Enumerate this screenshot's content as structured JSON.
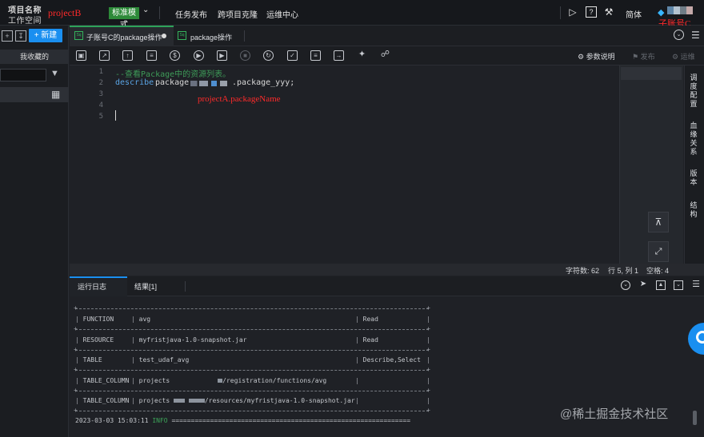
{
  "header": {
    "logo_line1": "项目名称",
    "logo_line2": "工作空间",
    "logo_annotation": "projectB",
    "mode": "标准模式",
    "nav": [
      "任务发布",
      "跨项目克隆",
      "运维中心"
    ],
    "lang": "简体",
    "account_annotation": "子账号C"
  },
  "sidebar": {
    "new_button": "+ 新建",
    "favorites_tab": "我收藏的",
    "search_placeholder": ""
  },
  "tabs": [
    {
      "label": "子账号C的package操作",
      "icon": "Sq",
      "active": true,
      "unsaved": true
    },
    {
      "label": "package操作",
      "icon": "Sq",
      "active": false
    }
  ],
  "toolbar": {
    "icons": [
      "save-icon",
      "save-as-icon",
      "upload-icon",
      "format-icon",
      "cost-icon",
      "run-icon",
      "run-advanced-icon",
      "stop-icon",
      "refresh-icon",
      "check-icon",
      "code-icon",
      "export-icon",
      "tools-icon",
      "lineage-icon"
    ],
    "params": "参数说明",
    "publish": "发布",
    "ops": "运维"
  },
  "editor": {
    "line_numbers": [
      "1",
      "2",
      "3",
      "4",
      "5"
    ],
    "line1": "--查看Package中的资源列表。",
    "line2_keyword": "describe",
    "line2_text": "package",
    "line2_suffix": ".package_yyy;",
    "annotation": "projectA.packageName"
  },
  "right_rail": [
    {
      "label": "调度配置"
    },
    {
      "label": "血缘关系"
    },
    {
      "label": "版本"
    },
    {
      "label": "结构"
    }
  ],
  "status": {
    "chars": "字符数: 62",
    "position": "行 5, 列 1",
    "spaces": "空格: 4"
  },
  "bottom_panel": {
    "tabs": [
      "运行日志",
      "结果[1]"
    ],
    "rows": [
      {
        "type": "FUNCTION",
        "name": "avg",
        "perm": "Read"
      },
      {
        "type": "RESOURCE",
        "name": "myfristjava-1.0-snapshot.jar",
        "perm": "Read"
      },
      {
        "type": "TABLE",
        "name": "test_udaf_avg",
        "perm": "Describe,Select"
      },
      {
        "type": "TABLE_COLUMN",
        "name_prefix": "projects",
        "name_suffix": "/registration/functions/avg",
        "perm": ""
      },
      {
        "type": "TABLE_COLUMN",
        "name_prefix": "projects",
        "name_suffix": "/resources/myfristjava-1.0-snapshot.jar",
        "perm": ""
      }
    ],
    "log_time": "2023-03-03 15:03:11",
    "log_level": "INFO",
    "log_tail": "=============================================================="
  },
  "watermark": "@稀土掘金技术社区",
  "colors": {
    "accent": "#1a8ff0",
    "success": "#2ea35a",
    "annotation_red": "#ff2a2a",
    "keyword": "#5aa4e4",
    "comment": "#3e9b58"
  }
}
